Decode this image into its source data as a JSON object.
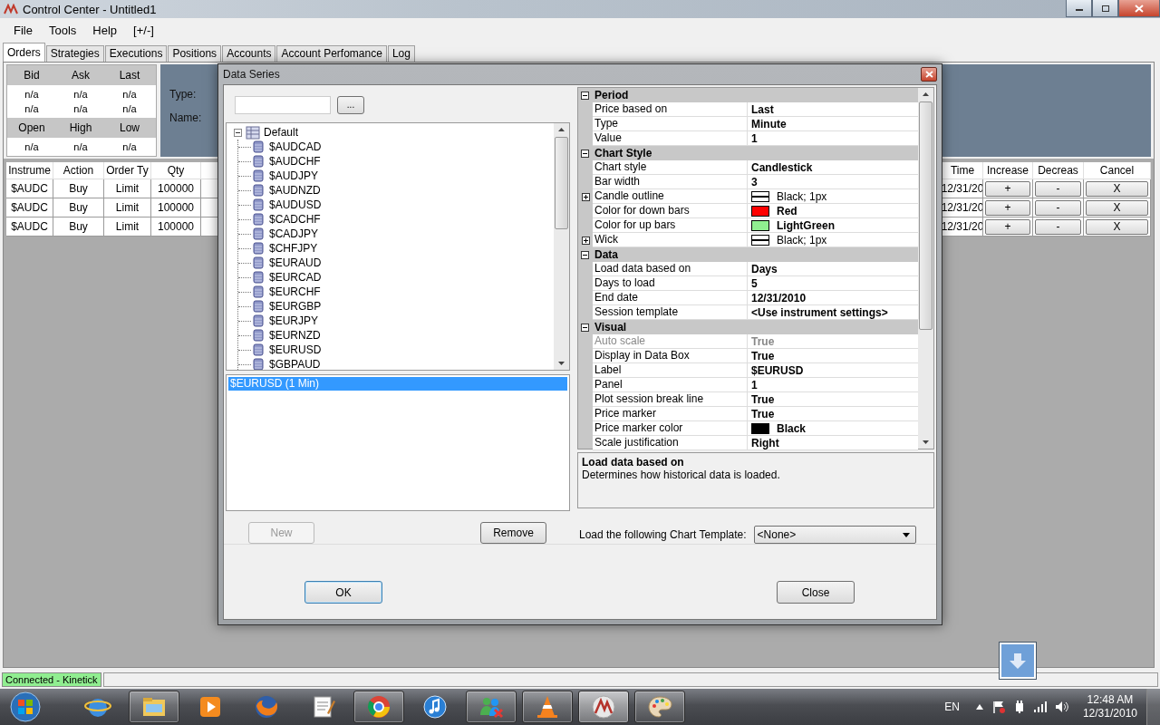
{
  "window": {
    "title": "Control Center - Untitled1"
  },
  "menu": [
    "File",
    "Tools",
    "Help",
    "[+/-]"
  ],
  "tabs": [
    {
      "label": "Orders",
      "selected": true
    },
    {
      "label": "Strategies",
      "selected": false
    },
    {
      "label": "Executions",
      "selected": false
    },
    {
      "label": "Positions",
      "selected": false
    },
    {
      "label": "Accounts",
      "selected": false
    },
    {
      "label": "Account Perfomance",
      "selected": false
    },
    {
      "label": "Log",
      "selected": false
    }
  ],
  "quote_groups": [
    {
      "columns": [
        {
          "header": "Bid",
          "values": [
            "n/a",
            "n/a"
          ]
        },
        {
          "header": "Ask",
          "values": [
            "n/a",
            "n/a"
          ]
        },
        {
          "header": "Last",
          "values": [
            "n/a",
            "n/a"
          ]
        }
      ]
    },
    {
      "columns": [
        {
          "header": "Open",
          "values": [
            "n/a"
          ]
        },
        {
          "header": "High",
          "values": [
            "n/a"
          ]
        },
        {
          "header": "Low",
          "values": [
            "n/a"
          ]
        }
      ]
    }
  ],
  "instrument_panel": {
    "labels": [
      "Type:",
      "Name:"
    ]
  },
  "orders": {
    "columns": [
      {
        "label": "Instrume",
        "kind": "text"
      },
      {
        "label": "Action",
        "kind": "text"
      },
      {
        "label": "Order Ty",
        "kind": "text"
      },
      {
        "label": "Qty",
        "kind": "text"
      },
      {
        "label": "Time",
        "kind": "text"
      },
      {
        "label": "Increase",
        "kind": "button"
      },
      {
        "label": "Decreas",
        "kind": "button"
      },
      {
        "label": "Cancel",
        "kind": "button"
      }
    ],
    "rows": [
      {
        "cells": [
          "$AUDC",
          "Buy",
          "Limit",
          "100000",
          "12/31/20",
          "+",
          "-",
          "X"
        ]
      },
      {
        "cells": [
          "$AUDC",
          "Buy",
          "Limit",
          "100000",
          "12/31/20",
          "+",
          "-",
          "X"
        ]
      },
      {
        "cells": [
          "$AUDC",
          "Buy",
          "Limit",
          "100000",
          "12/31/20",
          "+",
          "-",
          "X"
        ]
      }
    ]
  },
  "dialog": {
    "title": "Data Series",
    "browse_button": "...",
    "tree": {
      "label": "Default",
      "expanded": true,
      "children": [
        {
          "label": "$AUDCAD"
        },
        {
          "label": "$AUDCHF"
        },
        {
          "label": "$AUDJPY"
        },
        {
          "label": "$AUDNZD"
        },
        {
          "label": "$AUDUSD"
        },
        {
          "label": "$CADCHF"
        },
        {
          "label": "$CADJPY"
        },
        {
          "label": "$CHFJPY"
        },
        {
          "label": "$EURAUD"
        },
        {
          "label": "$EURCAD"
        },
        {
          "label": "$EURCHF"
        },
        {
          "label": "$EURGBP"
        },
        {
          "label": "$EURJPY"
        },
        {
          "label": "$EURNZD"
        },
        {
          "label": "$EURUSD"
        },
        {
          "label": "$GBPAUD"
        }
      ]
    },
    "series": [
      {
        "label": "$EURUSD (1 Min)",
        "selected": true
      }
    ],
    "new_button": {
      "label": "New",
      "disabled": true
    },
    "remove_button": {
      "label": "Remove",
      "disabled": false
    },
    "properties": [
      {
        "name": "Period",
        "expanded": true,
        "rows": [
          {
            "name": "Price based on",
            "value": "Last",
            "kind": "value",
            "disabled": false
          },
          {
            "name": "Type",
            "value": "Minute",
            "kind": "value",
            "disabled": false
          },
          {
            "name": "Value",
            "value": "1",
            "kind": "value",
            "disabled": false
          }
        ]
      },
      {
        "name": "Chart Style",
        "expanded": true,
        "rows": [
          {
            "name": "Chart style",
            "value": "Candlestick",
            "kind": "value",
            "disabled": false
          },
          {
            "name": "Bar width",
            "value": "3",
            "kind": "value",
            "disabled": false
          },
          {
            "name": "Candle outline",
            "value": "Black; 1px",
            "kind": "stroke",
            "expanded": false,
            "disabled": false
          },
          {
            "name": "Color for down bars",
            "value": "Red",
            "kind": "color",
            "color": "#ff0000",
            "disabled": false
          },
          {
            "name": "Color for up bars",
            "value": "LightGreen",
            "kind": "color",
            "color": "#90ee90",
            "disabled": false
          },
          {
            "name": "Wick",
            "value": "Black; 1px",
            "kind": "stroke",
            "expanded": false,
            "disabled": false
          }
        ]
      },
      {
        "name": "Data",
        "expanded": true,
        "rows": [
          {
            "name": "Load data based on",
            "value": "Days",
            "kind": "value",
            "disabled": false
          },
          {
            "name": "Days to load",
            "value": "5",
            "kind": "value",
            "disabled": false
          },
          {
            "name": "End date",
            "value": "12/31/2010",
            "kind": "value",
            "disabled": false
          },
          {
            "name": "Session template",
            "value": "<Use instrument settings>",
            "kind": "value",
            "disabled": false
          }
        ]
      },
      {
        "name": "Visual",
        "expanded": true,
        "rows": [
          {
            "name": "Auto scale",
            "value": "True",
            "kind": "value",
            "disabled": true
          },
          {
            "name": "Display in Data Box",
            "value": "True",
            "kind": "value",
            "disabled": false
          },
          {
            "name": "Label",
            "value": "$EURUSD",
            "kind": "value",
            "disabled": false
          },
          {
            "name": "Panel",
            "value": "1",
            "kind": "value",
            "disabled": false
          },
          {
            "name": "Plot session break line",
            "value": "True",
            "kind": "value",
            "disabled": false
          },
          {
            "name": "Price marker",
            "value": "True",
            "kind": "value",
            "disabled": false
          },
          {
            "name": "Price marker color",
            "value": "Black",
            "kind": "color",
            "color": "#000000",
            "disabled": false
          },
          {
            "name": "Scale justification",
            "value": "Right",
            "kind": "value",
            "disabled": false
          }
        ]
      }
    ],
    "description": {
      "title": "Load data based on",
      "text": "Determines how historical data is loaded."
    },
    "template": {
      "label": "Load the following Chart Template:",
      "value": "<None>"
    },
    "buttons": [
      "OK",
      "Close"
    ]
  },
  "status_bar": {
    "text": "Connected - Kinetick",
    "connected": true
  },
  "taskbar": {
    "apps": [
      {
        "kind": "globe",
        "running": false,
        "active": false
      },
      {
        "kind": "folder",
        "running": true,
        "active": false
      },
      {
        "kind": "play",
        "running": false,
        "active": false
      },
      {
        "kind": "fox",
        "running": false,
        "active": false
      },
      {
        "kind": "notepad",
        "running": false,
        "active": false
      },
      {
        "kind": "wheel",
        "running": true,
        "active": false
      },
      {
        "kind": "note",
        "running": false,
        "active": false
      },
      {
        "kind": "people",
        "running": true,
        "active": false
      },
      {
        "kind": "cone",
        "running": true,
        "active": false
      },
      {
        "kind": "swirl",
        "running": true,
        "active": true
      },
      {
        "kind": "palette",
        "running": true,
        "active": false
      }
    ],
    "language": "EN",
    "time": "12:48 AM",
    "date": "12/31/2010"
  }
}
